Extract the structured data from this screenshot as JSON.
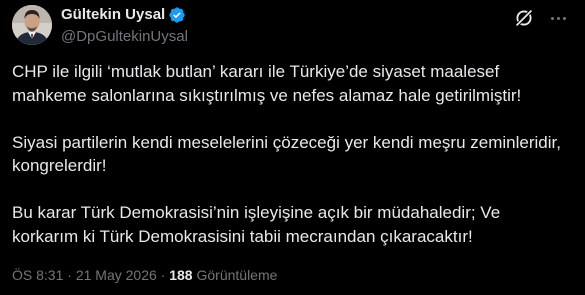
{
  "author": {
    "display_name": "Gültekin Uysal",
    "handle": "@DpGultekinUysal",
    "verified": true
  },
  "header_icons": {
    "grok": "grok-icon",
    "more": "more-options-icon"
  },
  "tweet": {
    "paragraphs": [
      "CHP ile ilgili ‘mutlak butlan’ kararı ile Türkiye’de siyaset maalesef\nmahkeme salonlarına sıkıştırılmış ve nefes alamaz hale getirilmiştir!",
      "Siyasi partilerin kendi meselelerini çözeceği yer kendi meşru zeminleridir,\nkongrelerdir!",
      "Bu karar Türk Demokrasisi’nin işleyişine açık bir müdahaledir; Ve\nkorkarım ki Türk Demokrasisini tabii mecraından çıkaracaktır!"
    ]
  },
  "meta": {
    "time": "ÖS 8:31",
    "date": "21 May 2026",
    "separator": "·",
    "views_count": "188",
    "views_label": "Görüntüleme"
  },
  "colors": {
    "background": "#000000",
    "text": "#e7e9ea",
    "secondary": "#71767b",
    "verified": "#1d9bf0"
  }
}
